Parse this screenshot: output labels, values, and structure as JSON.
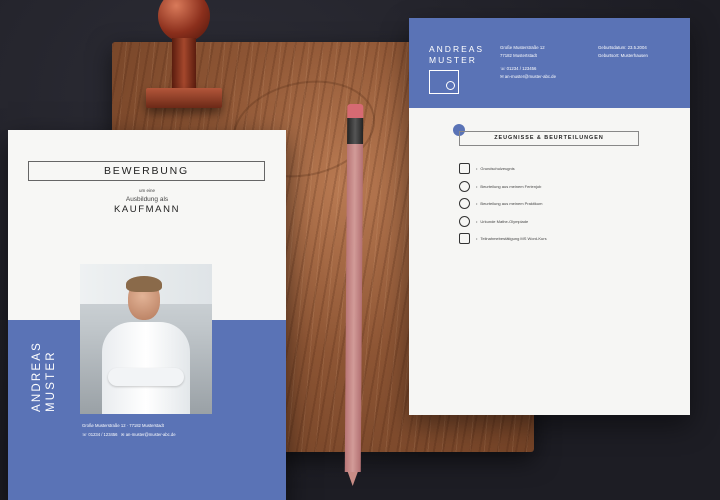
{
  "colors": {
    "accent": "#5a73b6",
    "paper": "#f6f6f4",
    "background": "#23232b",
    "wood": "#8d5534"
  },
  "right_document": {
    "name": "ANDREAS\nMUSTER",
    "address_line1": "Große Musterstraße 12",
    "address_line2": "77182 Mustertstadt",
    "phone": "01234 / 123456",
    "email": "an-muster@muster-abc.de",
    "birth_date": "Geburtsdatum: 23.5.2004",
    "birth_place": "Geburtsort: Musterhausen",
    "section_title": "ZEUGNISSE & BEURTEILUNGEN",
    "items": [
      {
        "icon": "document-icon",
        "label": "Grundschulzeugnis"
      },
      {
        "icon": "trophy-icon",
        "label": "Beurteilung aus meinem Ferienjob"
      },
      {
        "icon": "gear-icon",
        "label": "Beurteilung aus meinem Praktikum"
      },
      {
        "icon": "medal-icon",
        "label": "Urkunde Mathe-Olympiade"
      },
      {
        "icon": "certificate-icon",
        "label": "Teilnahmebestätigung MS Word-Kurs"
      }
    ]
  },
  "left_document": {
    "title": "BEWERBUNG",
    "subtitle_small": "um eine",
    "subtitle": "Ausbildung als",
    "job": "KAUFMANN",
    "name": "ANDREAS\nMUSTER",
    "footer_address": "Große Musterstraße 12 · 77182 Musterstadt",
    "footer_phone": "01234 / 123456",
    "footer_email": "an-muster@muster-abc.de"
  }
}
